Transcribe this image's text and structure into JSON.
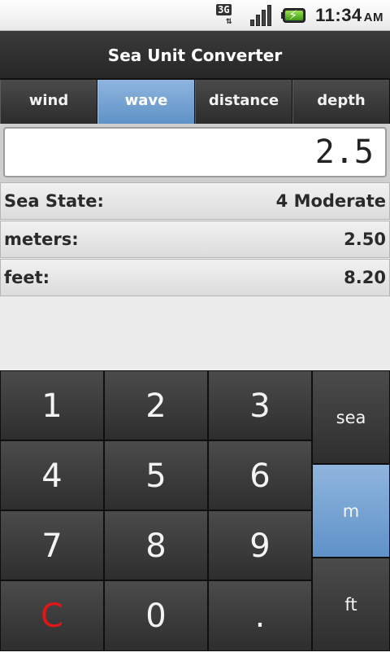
{
  "status_bar": {
    "network_label": "3G",
    "time": "11:34",
    "ampm": "AM",
    "icons": [
      "3g-data-icon",
      "signal-strength-icon",
      "battery-charging-icon"
    ]
  },
  "app": {
    "title": "Sea Unit Converter"
  },
  "tabs": [
    {
      "label": "wind",
      "selected": false
    },
    {
      "label": "wave",
      "selected": true
    },
    {
      "label": "distance",
      "selected": false
    },
    {
      "label": "depth",
      "selected": false
    }
  ],
  "input": {
    "value": "2.5"
  },
  "results": [
    {
      "label": "Sea State:",
      "value": "4 Moderate"
    },
    {
      "label": "meters:",
      "value": "2.50"
    },
    {
      "label": "feet:",
      "value": "8.20"
    }
  ],
  "keypad": {
    "digits": [
      "1",
      "2",
      "3",
      "4",
      "5",
      "6",
      "7",
      "8",
      "9",
      "C",
      "0",
      "."
    ],
    "units": [
      {
        "label": "sea",
        "selected": false
      },
      {
        "label": "m",
        "selected": true
      },
      {
        "label": "ft",
        "selected": false
      }
    ]
  },
  "colors": {
    "accent": "#6f9fd2",
    "clear_key": "#e21616"
  }
}
